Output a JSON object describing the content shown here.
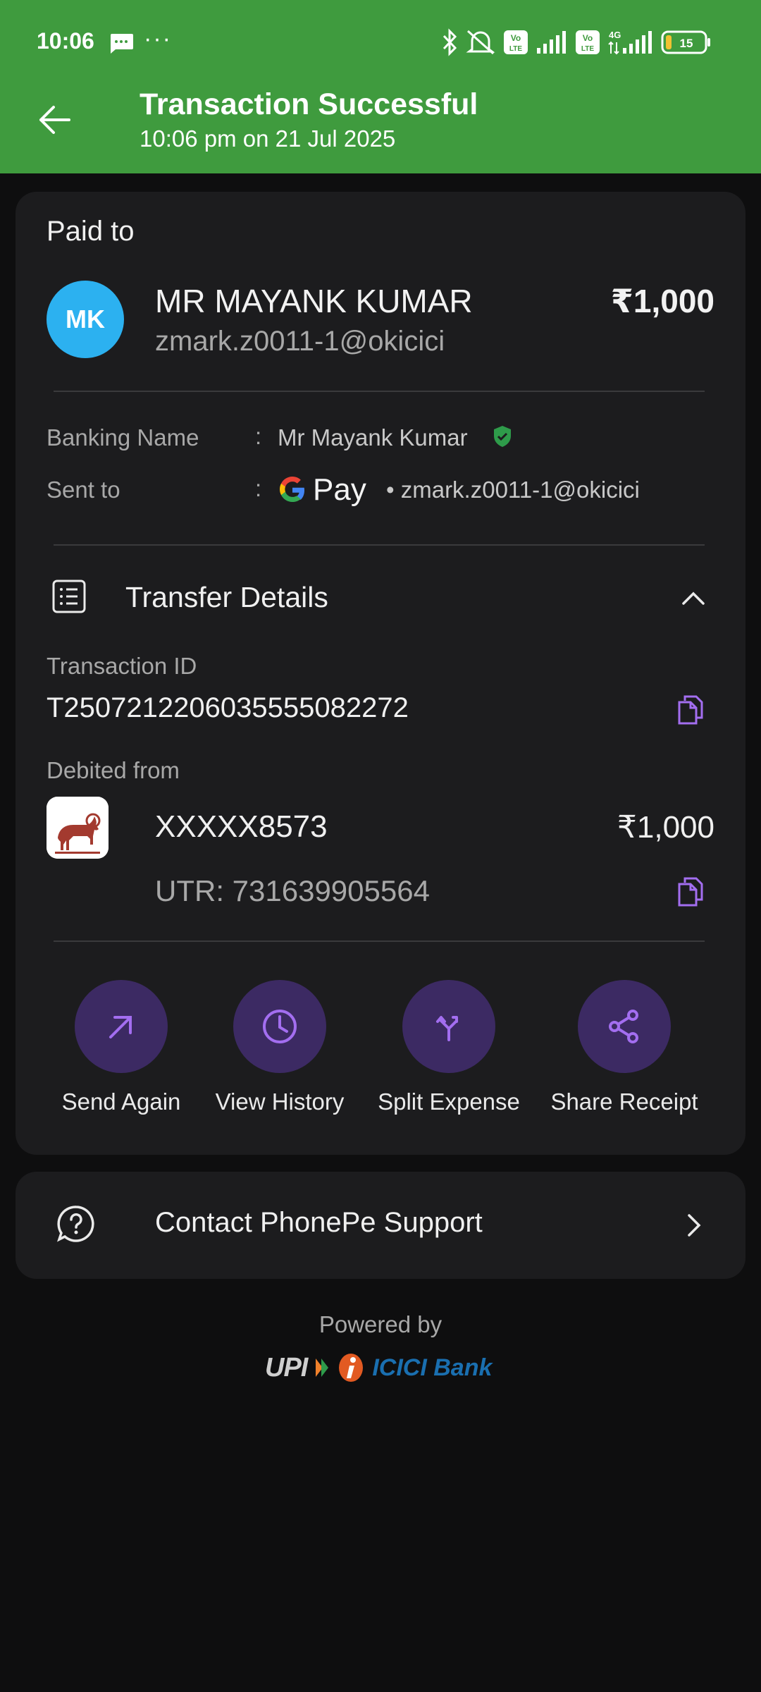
{
  "status_bar": {
    "time": "10:06",
    "dots": "···",
    "battery": "15",
    "icons": [
      "message-icon",
      "bluetooth-icon",
      "silent-icon",
      "volte-icon",
      "signal-icon",
      "volte-icon",
      "4g-icon",
      "signal-icon",
      "battery-icon"
    ]
  },
  "header": {
    "title": "Transaction Successful",
    "subtitle": "10:06 pm on 21 Jul 2025",
    "color": "#3f9b3e"
  },
  "payment": {
    "paid_to_label": "Paid to",
    "avatar_initials": "MK",
    "avatar_color": "#2cb1f0",
    "payee_name": "MR MAYANK  KUMAR",
    "payee_vpa": "zmark.z0011-1@okicici",
    "amount": "₹1,000",
    "banking_name_label": "Banking Name",
    "colon": ":",
    "banking_name": "Mr Mayank  Kumar",
    "sent_to_label": "Sent to",
    "sent_to_app": "Pay",
    "sent_to_vpa": "• zmark.z0011-1@okicici"
  },
  "transfer_details": {
    "title": "Transfer Details",
    "transaction_id_label": "Transaction ID",
    "transaction_id": "T2507212206035555082272",
    "debited_from_label": "Debited from",
    "account": "XXXXX8573",
    "debited_amount": "₹1,000",
    "utr": "UTR: 731639905564"
  },
  "actions": [
    {
      "label": "Send Again",
      "icon": "arrow-up-right-icon"
    },
    {
      "label": "View History",
      "icon": "clock-icon"
    },
    {
      "label": "Split Expense",
      "icon": "split-icon"
    },
    {
      "label": "Share Receipt",
      "icon": "share-icon"
    }
  ],
  "support": {
    "label": "Contact PhonePe Support"
  },
  "footer": {
    "powered_by": "Powered by",
    "upi": "UPI",
    "bank": "ICICI Bank"
  },
  "accent_color": "#a36ef0"
}
